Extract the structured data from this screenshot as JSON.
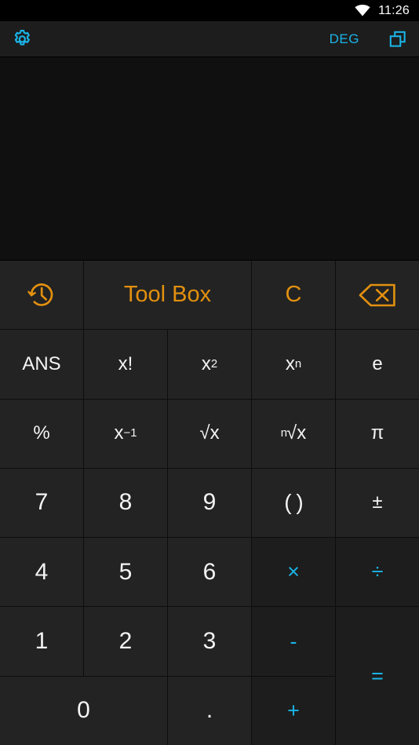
{
  "status_bar": {
    "time": "11:26",
    "wifi_icon": "wifi-icon"
  },
  "action_bar": {
    "settings_icon": "gear-icon",
    "angle_mode": "DEG",
    "windows_icon": "copy-windows-icon"
  },
  "display": {
    "expression": "",
    "cursor_visible": true
  },
  "colors": {
    "accent_cyan": "#1ab5e8",
    "accent_orange": "#e2900f",
    "key_bg": "#232323",
    "operator_bg": "#1d1d1d",
    "display_bg": "#101011",
    "caret": "#17879c"
  },
  "keypad": {
    "tool_row": [
      {
        "name": "history-button",
        "icon": "history-clock-icon",
        "label": ""
      },
      {
        "name": "tool-box-button",
        "icon": "",
        "label": "Tool Box"
      },
      {
        "name": "clear-button",
        "icon": "",
        "label": "C"
      },
      {
        "name": "backspace-button",
        "icon": "backspace-icon",
        "label": ""
      }
    ],
    "function_row_1": [
      {
        "name": "ans-key",
        "label": "ANS"
      },
      {
        "name": "factorial-key",
        "label": "x!"
      },
      {
        "name": "square-key",
        "label": "x",
        "sup": "2"
      },
      {
        "name": "power-key",
        "label": "x",
        "sup": "n"
      },
      {
        "name": "euler-key",
        "label": "e"
      }
    ],
    "function_row_2": [
      {
        "name": "percent-key",
        "label": "%"
      },
      {
        "name": "reciprocal-key",
        "label": "x",
        "sup": "−1"
      },
      {
        "name": "sqrt-key",
        "label": "√x"
      },
      {
        "name": "nth-root-key",
        "pre": "n",
        "label": "√x"
      },
      {
        "name": "pi-key",
        "label": "π"
      }
    ],
    "row_789": [
      {
        "name": "digit-7-key",
        "label": "7"
      },
      {
        "name": "digit-8-key",
        "label": "8"
      },
      {
        "name": "digit-9-key",
        "label": "9"
      },
      {
        "name": "parentheses-key",
        "label": "( )"
      },
      {
        "name": "plus-minus-key",
        "label": "±"
      }
    ],
    "row_456": [
      {
        "name": "digit-4-key",
        "label": "4"
      },
      {
        "name": "digit-5-key",
        "label": "5"
      },
      {
        "name": "digit-6-key",
        "label": "6"
      },
      {
        "name": "multiply-key",
        "label": "×"
      },
      {
        "name": "divide-key",
        "label": "÷"
      }
    ],
    "row_123": [
      {
        "name": "digit-1-key",
        "label": "1"
      },
      {
        "name": "digit-2-key",
        "label": "2"
      },
      {
        "name": "digit-3-key",
        "label": "3"
      },
      {
        "name": "minus-key",
        "label": "-"
      },
      {
        "name": "equals-key",
        "label": "="
      }
    ],
    "row_0": [
      {
        "name": "digit-0-key",
        "label": "0"
      },
      {
        "name": "decimal-point-key",
        "label": "."
      },
      {
        "name": "plus-key",
        "label": "+"
      }
    ]
  }
}
